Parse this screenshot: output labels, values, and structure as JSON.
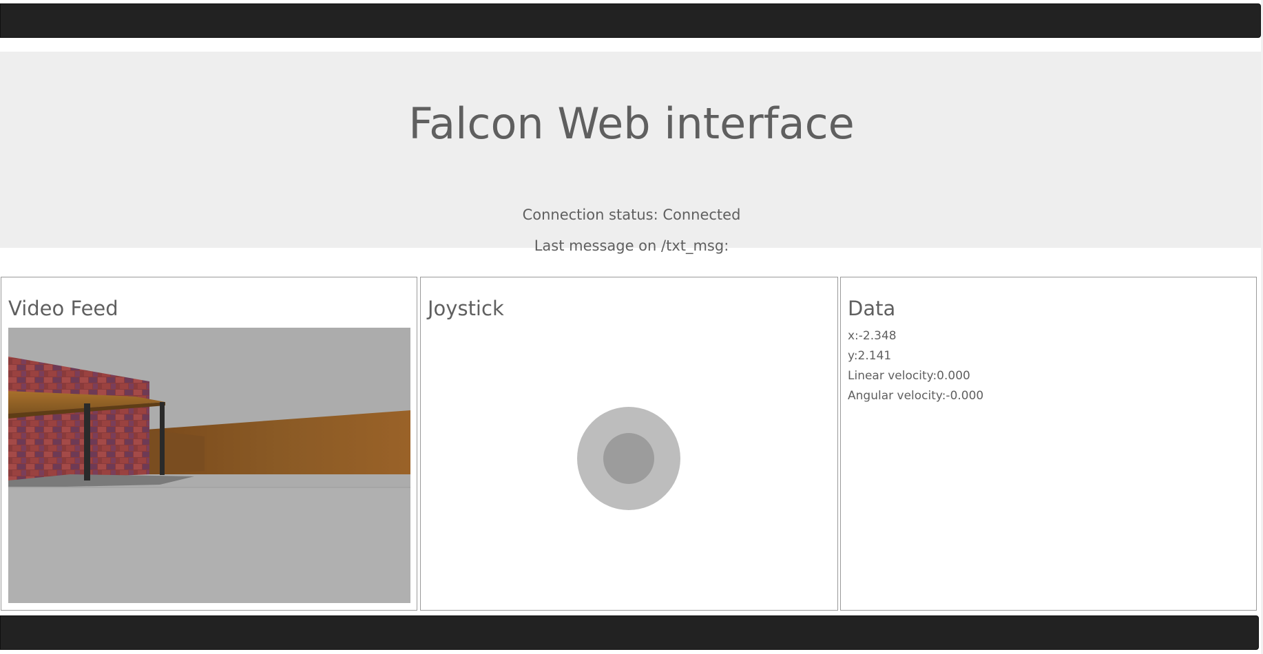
{
  "header": {
    "title": "Falcon Web interface",
    "connection_status": "Connection status: Connected",
    "last_message": "Last message on /txt_msg:"
  },
  "panels": {
    "video": {
      "title": "Video Feed"
    },
    "joystick": {
      "title": "Joystick"
    },
    "data": {
      "title": "Data",
      "x": "x:-2.348",
      "y": "y:2.141",
      "linear_velocity": "Linear velocity:0.000",
      "angular_velocity": "Angular velocity:-0.000"
    }
  },
  "colors": {
    "navbar": "#222222",
    "hero_background": "#eeeeee",
    "text": "#5f5f5f",
    "joystick_outer": "#bdbdbd",
    "joystick_inner": "#9c9c9c"
  }
}
